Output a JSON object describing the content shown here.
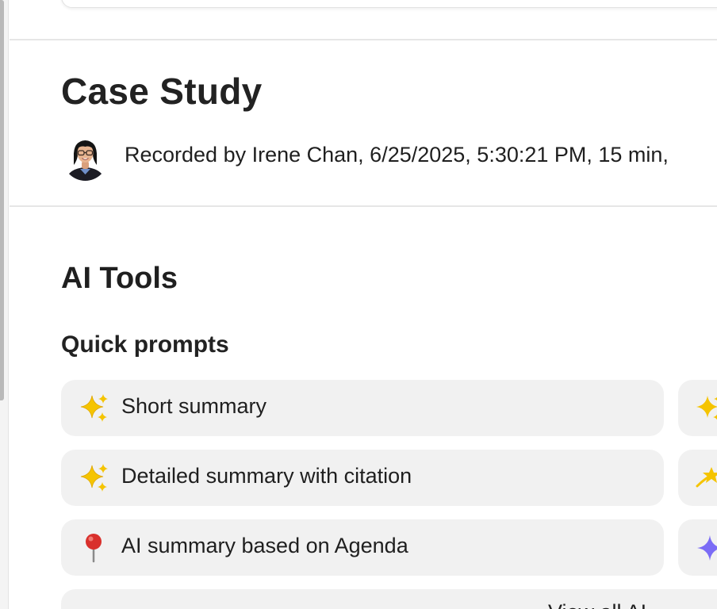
{
  "recording": {
    "title": "Case Study",
    "meta": "Recorded by Irene Chan, 6/25/2025, 5:30:21 PM, 15 min,",
    "author_avatar_icon": "user-avatar-photo"
  },
  "ai_tools": {
    "heading": "AI Tools",
    "quick_prompts_heading": "Quick prompts",
    "prompts": [
      {
        "label": "Short summary",
        "icon": "sparkles-icon"
      },
      {
        "label": "Detailed summary with citation",
        "icon": "sparkles-icon"
      },
      {
        "label": "AI summary based on Agenda",
        "icon": "round-pushpin-icon"
      }
    ],
    "prompts_right": [
      {
        "icon": "sparkles-icon"
      },
      {
        "icon": "dizzy-star-icon"
      },
      {
        "icon": "four-point-star-icon"
      }
    ],
    "view_all_label": "View all AI"
  },
  "colors": {
    "prompt_bg": "#f1f1f1",
    "divider": "#e6e6e6",
    "text": "#1f1f1f",
    "sparkle": "#f5c400",
    "ai_star": "#7b6cf6",
    "pin": "#d9302c"
  }
}
